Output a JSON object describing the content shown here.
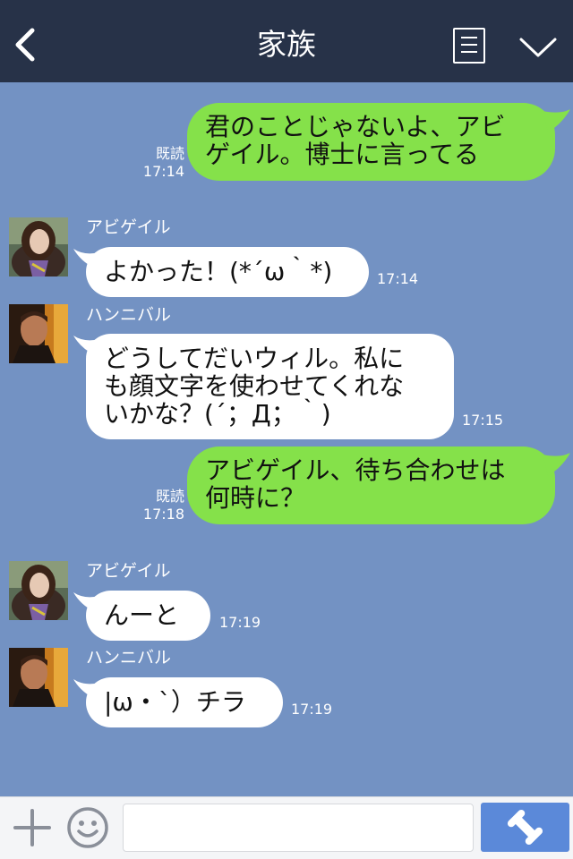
{
  "header": {
    "title": "家族"
  },
  "messages": [
    {
      "id": "m1",
      "side": "out",
      "lines": [
        "君のことじゃないよ、アビ",
        "ゲイル。博士に言ってる"
      ],
      "read_label": "既読",
      "time": "17:14"
    },
    {
      "id": "m2",
      "side": "in",
      "sender": "アビゲイル",
      "lines": [
        "よかった！(*´ω｀*)"
      ],
      "time": "17:14"
    },
    {
      "id": "m3",
      "side": "in",
      "sender": "ハンニバル",
      "lines": [
        "どうしてだいウィル。私に",
        "も顔文字を使わせてくれな",
        "いかな？(´；Д；｀)"
      ],
      "time": "17:15"
    },
    {
      "id": "m4",
      "side": "out",
      "lines": [
        "アビゲイル、待ち合わせは",
        "何時に？"
      ],
      "read_label": "既読",
      "time": "17:18"
    },
    {
      "id": "m5",
      "side": "in",
      "sender": "アビゲイル",
      "lines": [
        "んーと"
      ],
      "time": "17:19"
    },
    {
      "id": "m6",
      "side": "in",
      "sender": "ハンニバル",
      "lines": [
        "|ω・`）チラ"
      ],
      "time": "17:19"
    }
  ],
  "input": {
    "value": "",
    "placeholder": ""
  },
  "icons": {
    "back": "chevron-left-icon",
    "menu": "menu-list-icon",
    "expand": "chevron-down-icon",
    "add": "plus-icon",
    "emoji": "smiley-icon",
    "call": "phone-icon"
  },
  "colors": {
    "header_bg": "#273248",
    "chat_bg": "#7392c3",
    "outgoing_bubble": "#85e14a",
    "incoming_bubble": "#ffffff",
    "call_button": "#5b89d9"
  }
}
